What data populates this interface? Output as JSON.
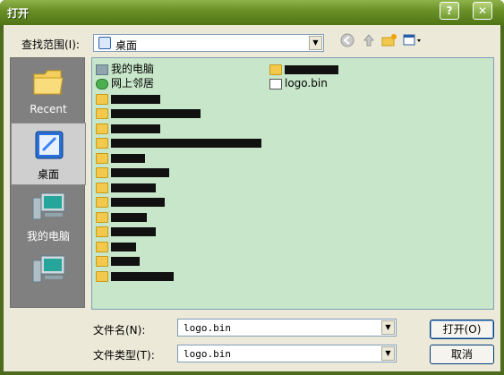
{
  "window": {
    "title": "打开",
    "help_label": "?",
    "close_label": "✕"
  },
  "lookin": {
    "label": "查找范围(I):",
    "value": "桌面"
  },
  "toolbar": {
    "back_icon": "back-arrow-icon",
    "up_icon": "up-folder-icon",
    "newfolder_icon": "new-folder-icon",
    "views_icon": "views-menu-icon"
  },
  "places": [
    {
      "label": "Recent",
      "icon": "recent-folder-icon"
    },
    {
      "label": "桌面",
      "icon": "desktop-icon"
    },
    {
      "label": "我的电脑",
      "icon": "my-computer-icon"
    },
    {
      "label": "",
      "icon": "network-computer-icon"
    }
  ],
  "files": {
    "mycomputer": "我的电脑",
    "network": "网上邻居",
    "logo": "logo.bin"
  },
  "form": {
    "filename_label": "文件名(N):",
    "filename_value": "logo.bin",
    "filetype_label": "文件类型(T):",
    "filetype_value": "logo.bin"
  },
  "buttons": {
    "open": "打开(O)",
    "cancel": "取消"
  }
}
